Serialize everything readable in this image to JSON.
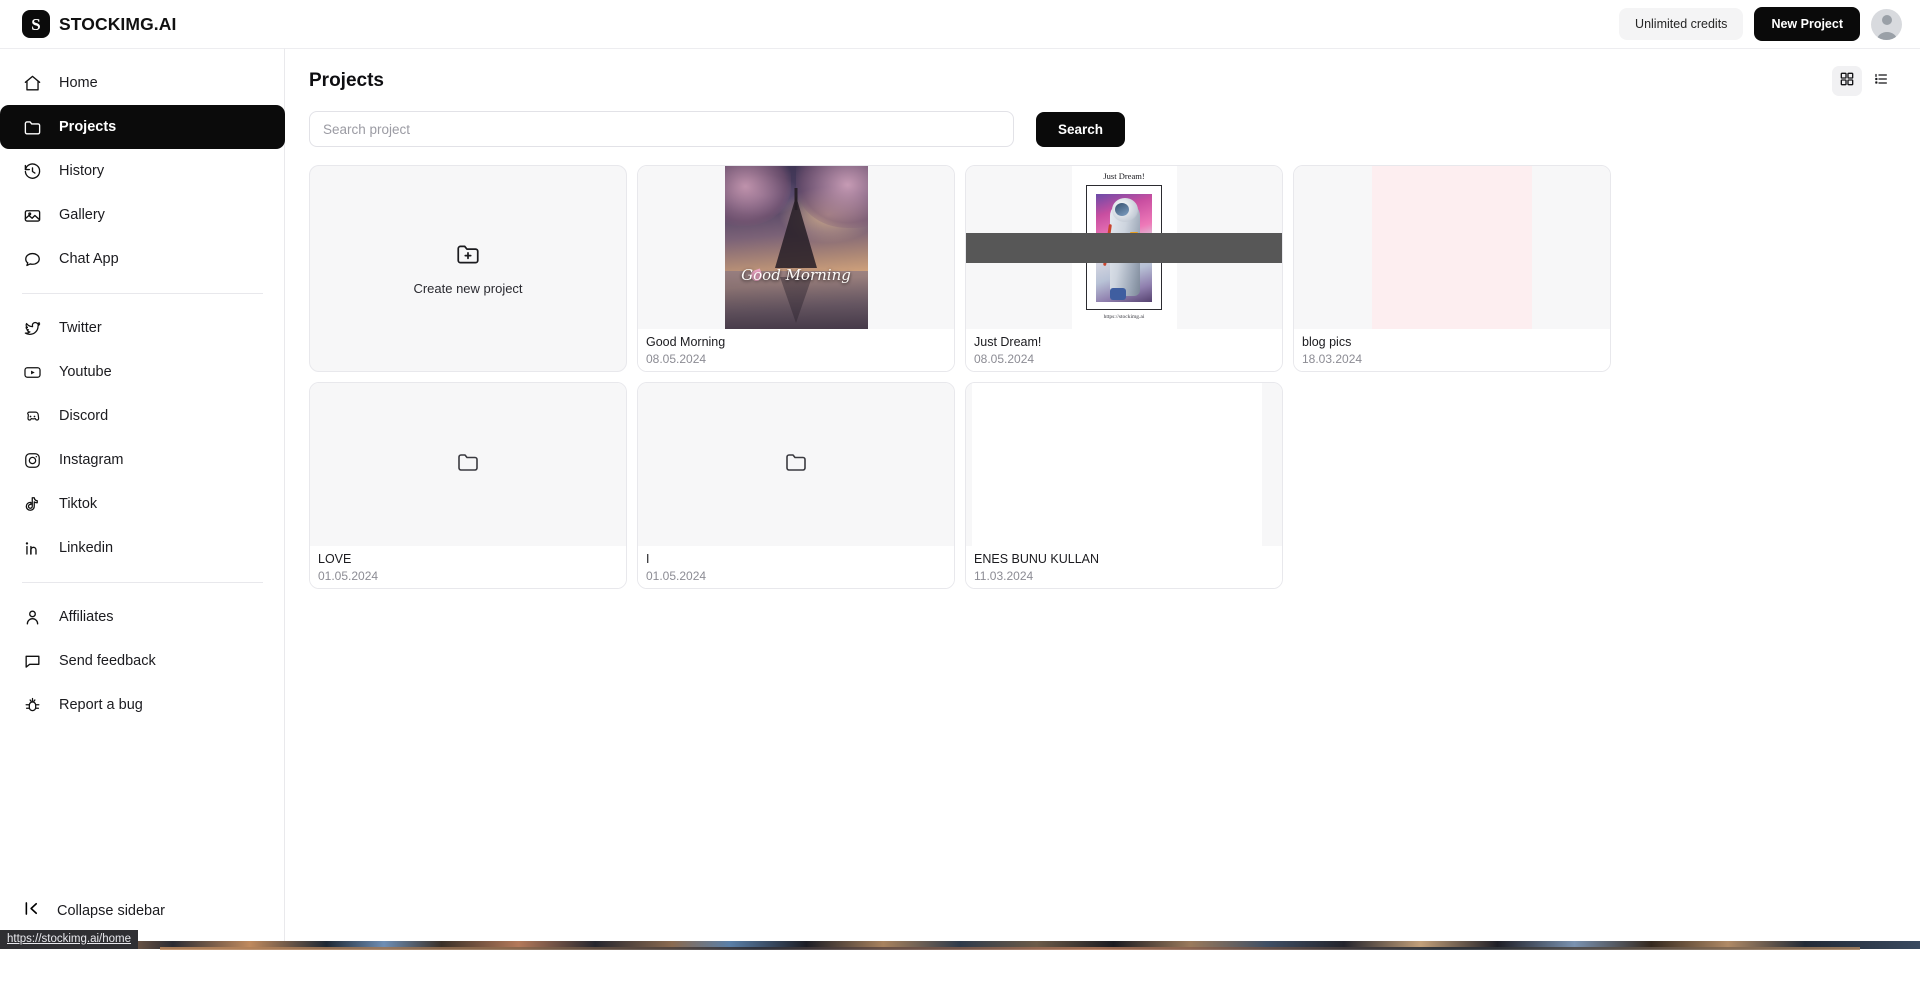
{
  "brand": {
    "mark_letter": "S",
    "name": "STOCKIMG.AI"
  },
  "topbar": {
    "credits_label": "Unlimited credits",
    "new_project_label": "New Project",
    "avatar_name": "user-avatar"
  },
  "sidebar": {
    "primary_items": [
      {
        "label": "Home",
        "icon": "home-icon",
        "active": false
      },
      {
        "label": "Projects",
        "icon": "folder-icon",
        "active": true
      },
      {
        "label": "History",
        "icon": "history-icon",
        "active": false
      },
      {
        "label": "Gallery",
        "icon": "gallery-icon",
        "active": false
      },
      {
        "label": "Chat App",
        "icon": "chat-bubble-icon",
        "active": false
      }
    ],
    "social_items": [
      {
        "label": "Twitter",
        "icon": "twitter-icon"
      },
      {
        "label": "Youtube",
        "icon": "youtube-icon"
      },
      {
        "label": "Discord",
        "icon": "discord-icon"
      },
      {
        "label": "Instagram",
        "icon": "instagram-icon"
      },
      {
        "label": "Tiktok",
        "icon": "tiktok-icon"
      },
      {
        "label": "Linkedin",
        "icon": "linkedin-icon"
      }
    ],
    "support_items": [
      {
        "label": "Affiliates",
        "icon": "user-icon"
      },
      {
        "label": "Send feedback",
        "icon": "message-icon"
      },
      {
        "label": "Report a bug",
        "icon": "bug-icon"
      }
    ],
    "collapse_label": "Collapse sidebar",
    "collapse_icon": "chevron-left-bar-icon"
  },
  "main": {
    "page_title": "Projects",
    "view_modes": [
      {
        "name": "grid-view",
        "icon": "grid-icon",
        "active": true
      },
      {
        "name": "list-view",
        "icon": "list-icon",
        "active": false
      }
    ],
    "search": {
      "placeholder": "Search project",
      "value": "",
      "button_label": "Search"
    },
    "create_card": {
      "label": "Create new project",
      "icon": "folder-plus-icon"
    },
    "projects": [
      {
        "name": "Good Morning",
        "date": "08.05.2024",
        "thumb": "good-morning-art",
        "overlay_text": "Good Morning"
      },
      {
        "name": "Just Dream!",
        "date": "08.05.2024",
        "thumb": "just-dream-poster",
        "poster_title": "Just Dream!",
        "poster_caption": "https://stockimg.ai"
      },
      {
        "name": "blog pics",
        "date": "18.03.2024",
        "thumb": "pink-blank"
      },
      {
        "name": "LOVE",
        "date": "01.05.2024",
        "thumb": "folder-placeholder"
      },
      {
        "name": "I",
        "date": "01.05.2024",
        "thumb": "folder-placeholder"
      },
      {
        "name": "ENES BUNU KULLAN",
        "date": "11.03.2024",
        "thumb": "white-blank"
      }
    ]
  },
  "status_bar": {
    "url": "https://stockimg.ai/home"
  },
  "colors": {
    "accent_dark": "#0a0a0a",
    "page_bg": "#ffffff",
    "thumb_bg": "#f7f7f8",
    "border": "#e8e8ec",
    "muted_text": "#8c8c94",
    "pink_thumb": "#fdeef0",
    "band_gray": "#575757"
  }
}
